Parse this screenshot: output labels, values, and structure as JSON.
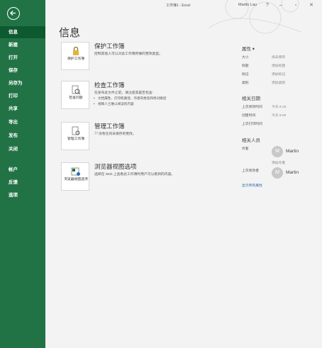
{
  "window": {
    "title": "工作簿1 - Excel",
    "user_name": "Martin Lau",
    "help_icon": "question-icon",
    "min_icon": "minimize-icon",
    "restore_icon": "restore-icon",
    "close_icon": "close-icon"
  },
  "nav": {
    "back_icon": "back-arrow-icon",
    "items": [
      {
        "label": "信息",
        "active": true
      },
      {
        "label": "新建"
      },
      {
        "label": "打开"
      },
      {
        "label": "保存"
      },
      {
        "label": "另存为"
      },
      {
        "label": "打印"
      },
      {
        "label": "共享"
      },
      {
        "label": "导出"
      },
      {
        "label": "发布"
      },
      {
        "label": "关闭"
      },
      {
        "label": "帐户"
      },
      {
        "label": "反馈"
      },
      {
        "label": "选项"
      }
    ]
  },
  "page_title": "信息",
  "sections": {
    "protect": {
      "tile_label": "保护工作簿",
      "title": "保护工作簿",
      "desc": "控制其他人可以对此工作簿所做的更改类型。"
    },
    "inspect": {
      "tile_label": "检查问题",
      "title": "检查工作簿",
      "desc": "在发布此文件之前，请注意其是否包含:",
      "bullets": [
        "文档属性、打印机路径、作者的姓名和绝对路径",
        "视障人士难以阅读的内容"
      ]
    },
    "manage": {
      "tile_label": "管理工作簿",
      "title": "管理工作簿",
      "desc": "没有任何未保存的更改。"
    },
    "browser": {
      "tile_label": "浏览器视图选项",
      "title": "浏览器视图选项",
      "desc": "选择在 Web 上查看此工作簿时用户可以看到的内容。"
    }
  },
  "properties": {
    "heading": "属性 ▾",
    "rows": [
      {
        "label": "大小",
        "value": "尚未保存"
      },
      {
        "label": "标题",
        "value": "添加标题"
      },
      {
        "label": "标记",
        "value": "添加标记"
      },
      {
        "label": "类别",
        "value": "添加类别"
      }
    ],
    "dates_heading": "相关日期",
    "dates": [
      {
        "label": "上次修改时间",
        "value": "今天 8:19"
      },
      {
        "label": "创建时间",
        "value": "今天 8:49"
      },
      {
        "label": "上次打印时间",
        "value": ""
      }
    ],
    "people_heading": "相关人员",
    "author_label": "作者",
    "author_name": "Martin",
    "add_author": "添加作者",
    "last_modified_by_label": "上次修改者",
    "last_modified_by_name": "Martin",
    "avatar_letter": "M",
    "show_all": "显示所有属性"
  }
}
